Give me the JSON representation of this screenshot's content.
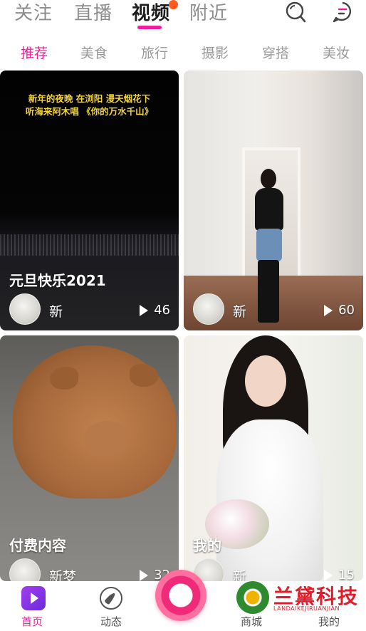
{
  "top_tabs": [
    {
      "label": "关注",
      "active": false
    },
    {
      "label": "直播",
      "active": false
    },
    {
      "label": "视频",
      "active": true
    },
    {
      "label": "附近",
      "active": false
    }
  ],
  "top_icons": [
    "search-icon",
    "message-icon"
  ],
  "categories": [
    {
      "label": "推荐",
      "active": true
    },
    {
      "label": "美食",
      "active": false
    },
    {
      "label": "旅行",
      "active": false
    },
    {
      "label": "摄影",
      "active": false
    },
    {
      "label": "穿搭",
      "active": false
    },
    {
      "label": "美妆",
      "active": false
    }
  ],
  "cards": [
    {
      "caption": "元旦快乐2021",
      "author": "新",
      "plays": "46",
      "overlay_lines": [
        "新年的夜晚 在浏阳 漫天烟花下",
        "听海来阿木唱 《你的万水千山》"
      ]
    },
    {
      "caption": "",
      "author": "新",
      "plays": "60"
    },
    {
      "caption": "付费内容",
      "author": "新梦",
      "plays": "32"
    },
    {
      "caption": "我的",
      "author": "新",
      "plays": "15"
    }
  ],
  "bottom_nav": [
    {
      "label": "首页",
      "icon": "home-play-icon",
      "active": true
    },
    {
      "label": "动态",
      "icon": "compass-icon",
      "active": false
    },
    {
      "label": "",
      "icon": "camera-record-icon",
      "active": false
    },
    {
      "label": "商城",
      "icon": "",
      "active": false
    },
    {
      "label": "我的",
      "icon": "",
      "active": false
    }
  ],
  "watermark": {
    "text": "兰黛科技",
    "subtext": "LANDAIKEJIRUANJIAN"
  },
  "colors": {
    "accent": "#ef1f9a",
    "notify_dot": "#ff5a1e",
    "watermark": "#e11d2c"
  }
}
